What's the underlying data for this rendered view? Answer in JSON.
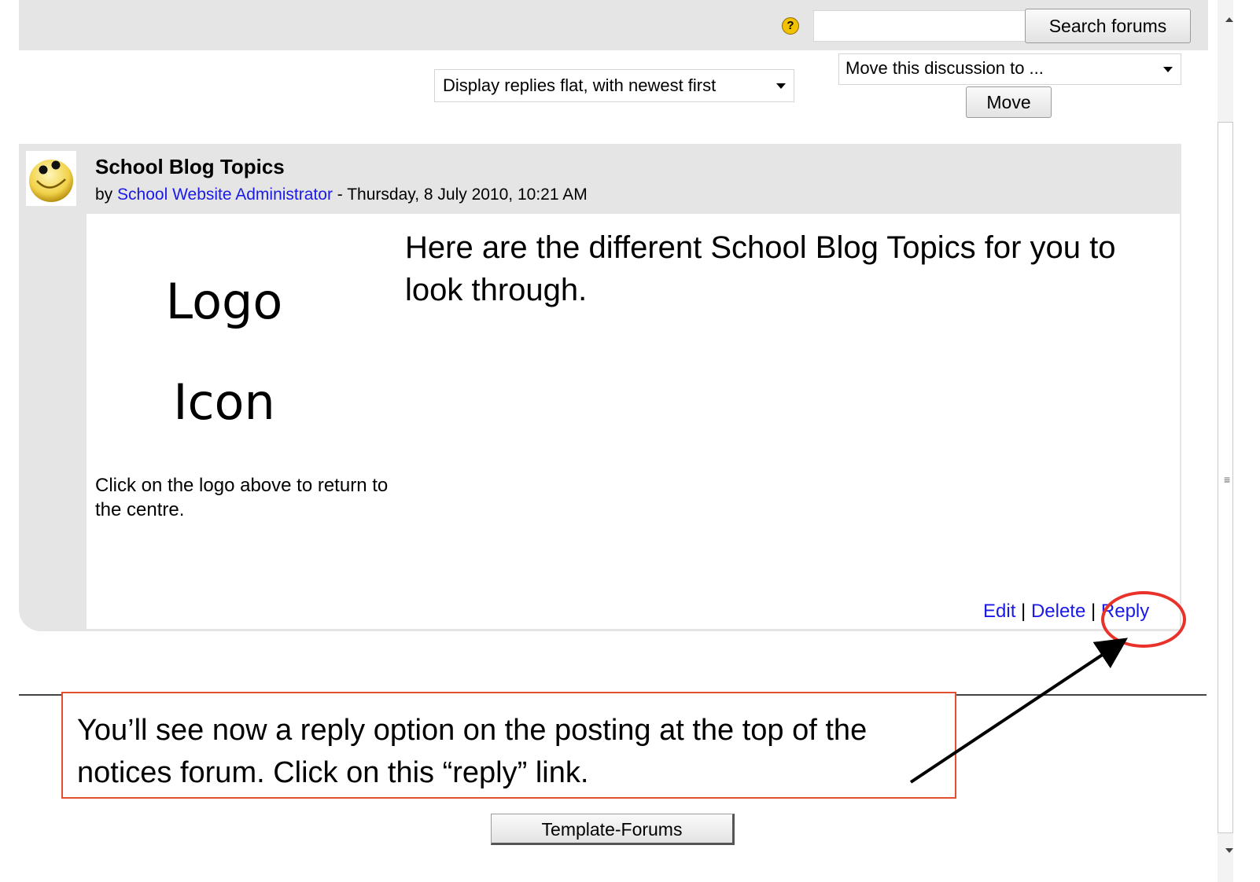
{
  "search": {
    "input_value": "",
    "help_label": "?",
    "button_label": "Search forums"
  },
  "discussion_controls": {
    "display_mode": "Display replies flat, with newest first",
    "move_select": "Move this discussion to ...",
    "move_button": "Move"
  },
  "post": {
    "subject": "School Blog Topics",
    "by_prefix": "by",
    "author": "School Website Administrator",
    "date_separator": " - ",
    "date": "Thursday, 8 July 2010, 10:21 AM",
    "logo_image_text": "Logo Icon",
    "logo_caption": "Click on the logo above to return to the centre.",
    "message": "Here are the different School Blog Topics for you to look through.",
    "actions": {
      "edit": "Edit",
      "delete": "Delete",
      "reply": "Reply",
      "separator": " | "
    }
  },
  "annotation": {
    "callout_text": "You’ll see now a reply option on the posting at the top of the notices forum. Click on this “reply” link.",
    "highlight_color": "#e8322a"
  },
  "footer": {
    "template_button": "Template-Forums"
  },
  "scrollbar": {
    "grip_icon": "grip-icon"
  }
}
